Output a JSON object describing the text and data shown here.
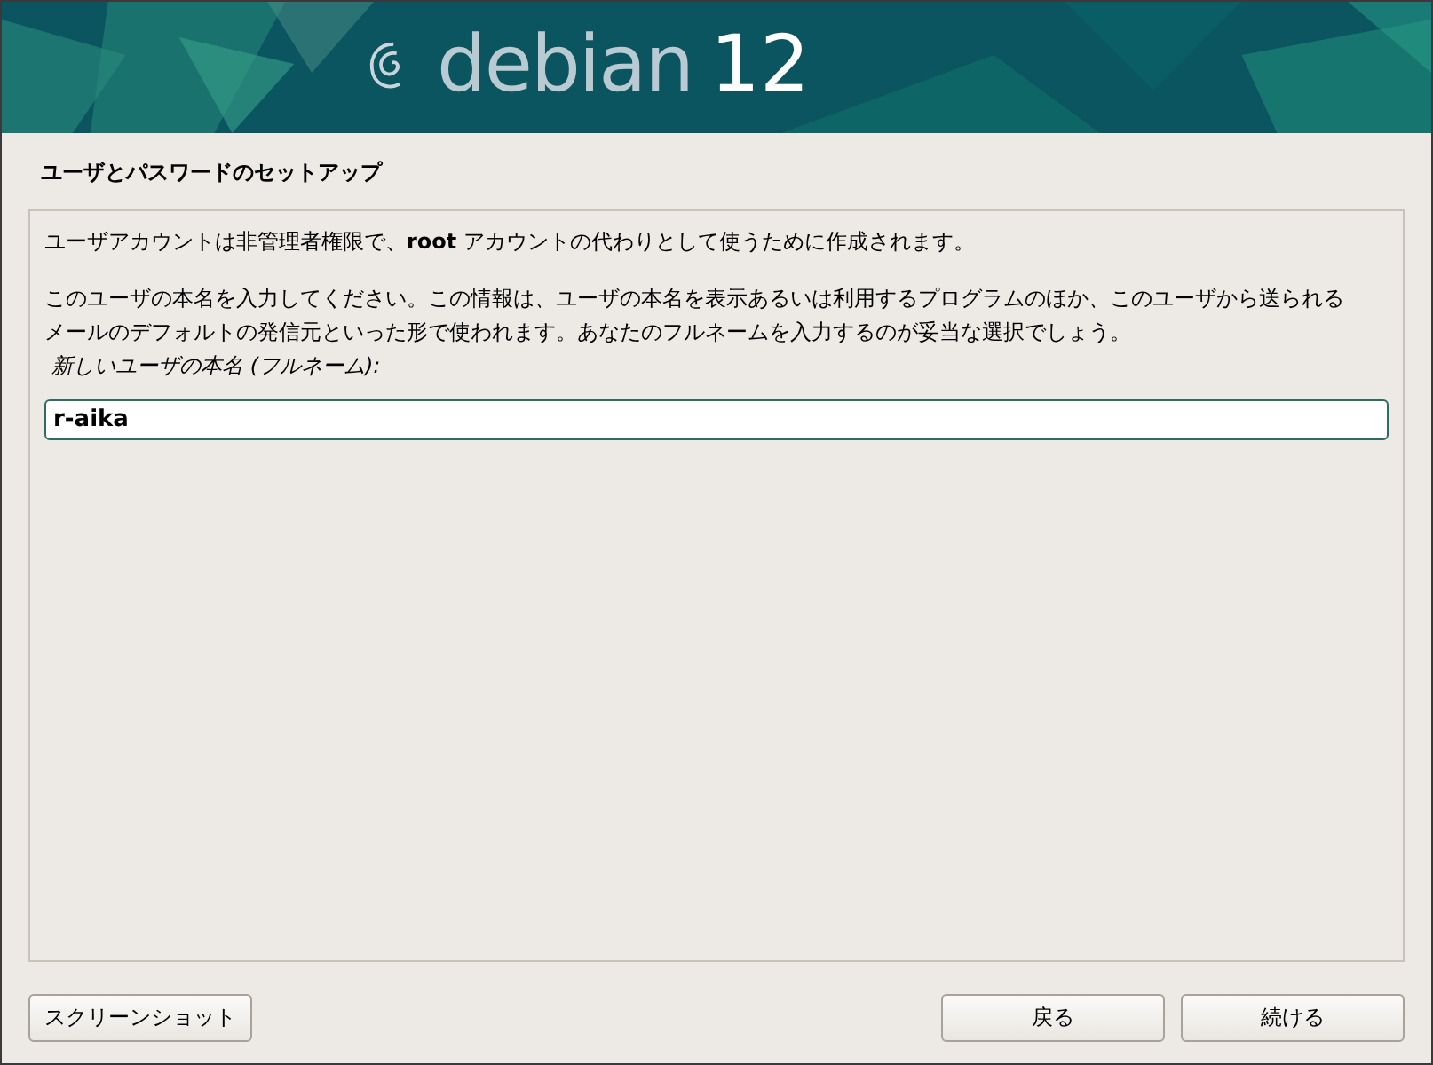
{
  "banner": {
    "brand": "debian",
    "version": "12"
  },
  "title": "ユーザとパスワードのセットアップ",
  "paragraphs": [
    "ユーザアカウントは非管理者権限で、**root** アカウントの代わりとして使うために作成されます。",
    "このユーザの本名を入力してください。この情報は、ユーザの本名を表示あるいは利用するプログラムのほか、このユーザから送られるメールのデフォルトの発信元といった形で使われます。あなたのフルネームを入力するのが妥当な選択でしょう。"
  ],
  "field": {
    "label": "新しいユーザの本名 (フルネーム):",
    "value": "r-aika"
  },
  "buttons": [
    {
      "label": "スクリーンショット",
      "kind": "left"
    },
    {
      "label": "戻る",
      "kind": "right"
    },
    {
      "label": "続ける",
      "kind": "right"
    }
  ]
}
